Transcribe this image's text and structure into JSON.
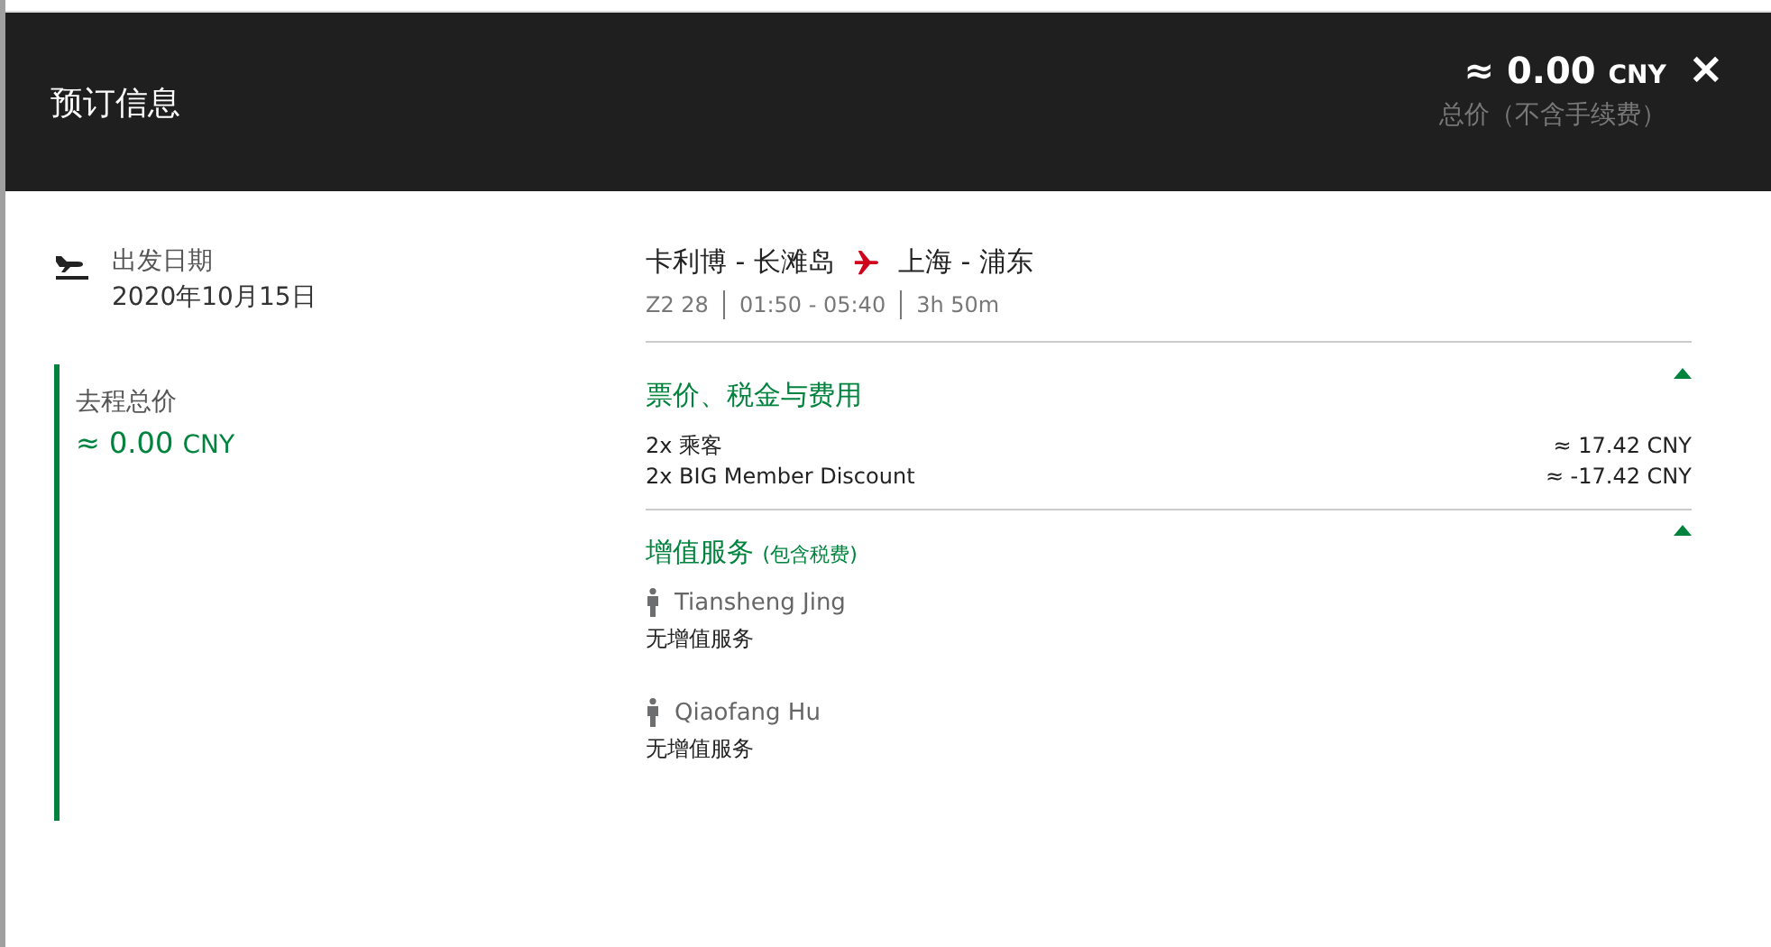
{
  "header": {
    "title": "预订信息",
    "price": "≈ 0.00",
    "currency": "CNY",
    "price_note": "总价（不含手续费）",
    "close": "×"
  },
  "departure": {
    "label": "出发日期",
    "date": "2020年10月15日"
  },
  "outbound_total": {
    "label": "去程总价",
    "price": "≈ 0.00",
    "currency": "CNY"
  },
  "flight": {
    "from": "卡利博 - 长滩岛",
    "to": "上海 - 浦东",
    "details": [
      "Z2 28",
      "01:50 - 05:40",
      "3h 50m"
    ]
  },
  "fare_section": {
    "title": "票价、税金与费用",
    "expanded": true,
    "rows": [
      {
        "label": "2x 乘客",
        "amount": "≈ 17.42 CNY"
      },
      {
        "label": "2x BIG Member Discount",
        "amount": "≈ -17.42 CNY"
      }
    ]
  },
  "services_section": {
    "title": "增值服务",
    "subtitle": "(包含税费)",
    "expanded": true,
    "passengers": [
      {
        "name": "Tiansheng Jing",
        "service": "无增值服务"
      },
      {
        "name": "Qiaofang Hu",
        "service": "无增值服务"
      }
    ]
  }
}
